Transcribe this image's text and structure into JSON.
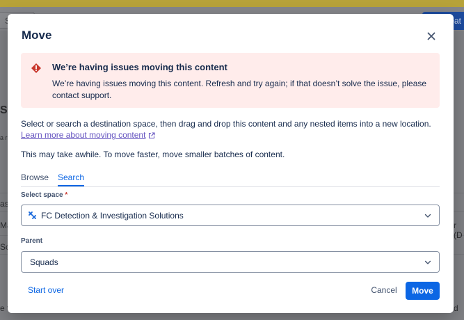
{
  "background": {
    "search_fragment": "S",
    "create_fragment": "eat",
    "left_fragments": [
      "SC",
      "a r",
      "as",
      "Ma",
      "Sc",
      "e th"
    ],
    "right_fragments": [
      "r (D",
      "d"
    ]
  },
  "modal": {
    "title": "Move",
    "close_icon": "close-icon",
    "error": {
      "icon": "error-icon",
      "title": "We’re having issues moving this content",
      "body": "We’re having issues moving this content. Refresh and try again; if that doesn’t solve the issue, please contact support."
    },
    "description": "Select or search a destination space, then drag and drop this content and any nested items into a new location.",
    "learn_more": "Learn more about moving content",
    "note": "This may take awhile. To move faster, move smaller batches of content.",
    "tabs": [
      {
        "label": "Browse",
        "selected": false
      },
      {
        "label": "Search",
        "selected": true
      }
    ],
    "space_field": {
      "label": "Select space",
      "required_marker": "*",
      "value": "FC Detection & Investigation Solutions"
    },
    "parent_field": {
      "label": "Parent",
      "value": "Squads"
    },
    "footer": {
      "start_over": "Start over",
      "cancel": "Cancel",
      "move": "Move"
    }
  },
  "colors": {
    "primary": "#0c66e4",
    "error_bg": "#ffeceb",
    "error_icon": "#c9372c",
    "link_visited": "#6554c0"
  }
}
